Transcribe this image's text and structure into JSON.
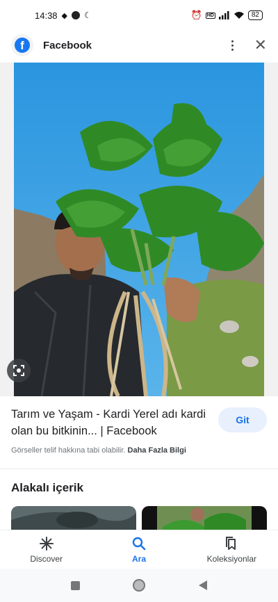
{
  "status_bar": {
    "time": "14:38",
    "battery": "82"
  },
  "header": {
    "source_name": "Facebook"
  },
  "result": {
    "title": "Tarım ve Yaşam - Kardi Yerel adı kardi olan bu bitkinin... | Facebook",
    "visit_label": "Git",
    "copyright_text": "Görseller telif hakkına tabi olabilir.",
    "learn_more": "Daha Fazla Bilgi"
  },
  "related": {
    "title": "Alakalı içerik"
  },
  "bottom_nav": [
    {
      "label": "Discover",
      "icon": "asterisk-icon"
    },
    {
      "label": "Ara",
      "icon": "search-icon"
    },
    {
      "label": "Koleksiyonlar",
      "icon": "bookmarks-icon"
    }
  ],
  "colors": {
    "accent": "#1a73e8",
    "facebook_blue": "#1877f2",
    "sky": "#2b9be0"
  }
}
